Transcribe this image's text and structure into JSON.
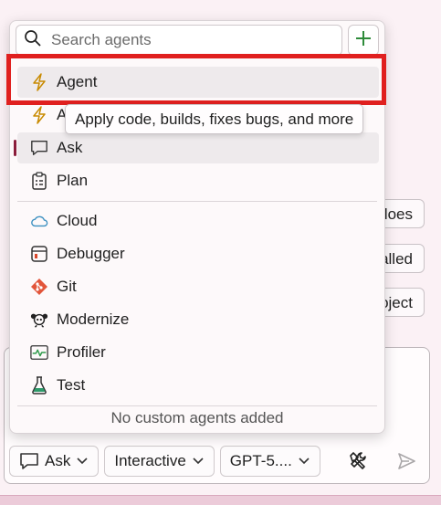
{
  "background": {
    "pills": [
      "does",
      "alled",
      "oject"
    ]
  },
  "toolbar": {
    "mode_label": "Ask",
    "interaction_label": "Interactive",
    "model_label": "GPT-5...."
  },
  "popup": {
    "search_placeholder": "Search agents",
    "items": [
      {
        "label": "Agent",
        "icon": "lightning-icon"
      },
      {
        "label": "A",
        "icon": "lightning-icon"
      },
      {
        "label": "Ask",
        "icon": "chat-bubble-icon"
      },
      {
        "label": "Plan",
        "icon": "clipboard-icon"
      },
      {
        "label": "Cloud",
        "icon": "cloud-icon"
      },
      {
        "label": "Debugger",
        "icon": "debugger-window-icon"
      },
      {
        "label": "Git",
        "icon": "git-icon"
      },
      {
        "label": "Modernize",
        "icon": "modernize-icon"
      },
      {
        "label": "Profiler",
        "icon": "profiler-icon"
      },
      {
        "label": "Test",
        "icon": "test-flask-icon"
      }
    ],
    "footer": "No custom agents added",
    "tooltip": "Apply code, builds, fixes bugs, and more"
  },
  "colors": {
    "highlight": "#e0201f",
    "accent_add": "#2e8b3a",
    "selected_bar": "#8b1d3b"
  }
}
